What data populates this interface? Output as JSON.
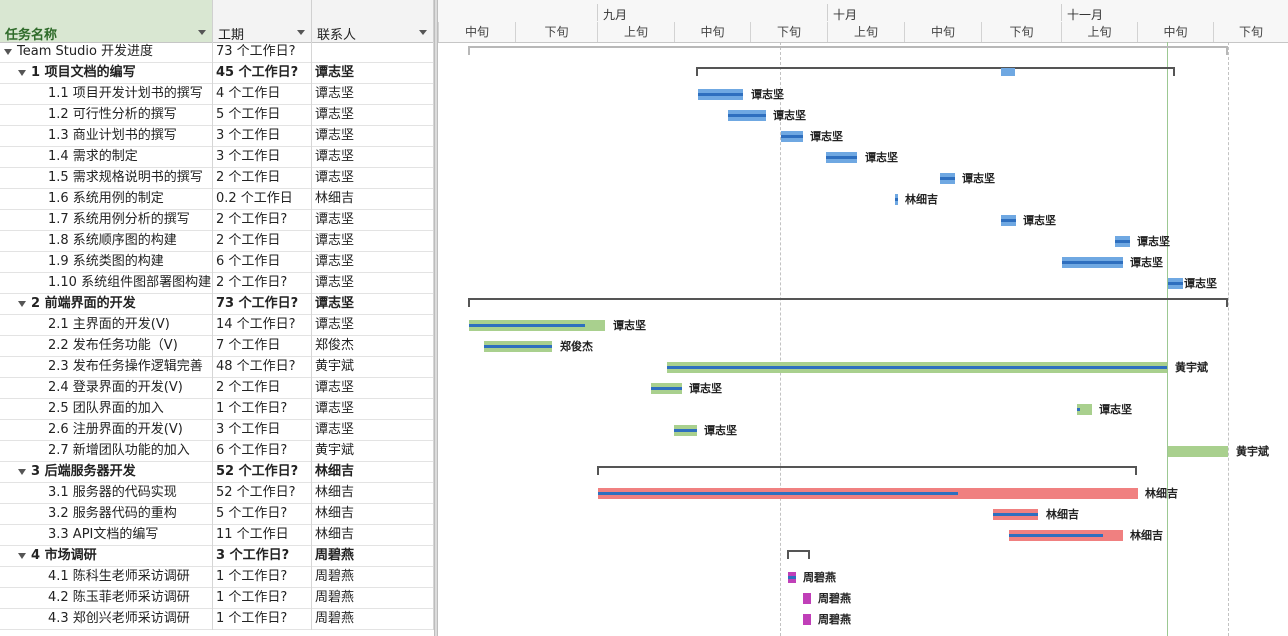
{
  "columns": {
    "name": "任务名称",
    "duration": "工期",
    "contact": "联系人"
  },
  "timescale": {
    "months": [
      "九月",
      "十月",
      "十一月"
    ],
    "periods": [
      "中旬",
      "下旬",
      "上旬",
      "中旬",
      "下旬",
      "上旬",
      "中旬",
      "下旬",
      "上旬",
      "中旬",
      "下旬"
    ]
  },
  "colors": {
    "summary_bar": "#555555",
    "task_blue": "#6fa8e2",
    "task_green": "#a9d08e",
    "task_red": "#f08080",
    "task_magenta": "#c03fb8",
    "progress": "#2e6fbf"
  },
  "tasks": [
    {
      "name": "Team Studio 开发进度",
      "duration": "73 个工作日?",
      "contact": "",
      "level": 0,
      "summary": true
    },
    {
      "name": "1 项目文档的编写",
      "duration": "45 个工作日?",
      "contact": "谭志坚",
      "level": 1,
      "summary": true
    },
    {
      "name": "1.1 项目开发计划书的撰写",
      "duration": "4 个工作日",
      "contact": "谭志坚",
      "level": 2
    },
    {
      "name": "1.2 可行性分析的撰写",
      "duration": "5 个工作日",
      "contact": "谭志坚",
      "level": 2
    },
    {
      "name": "1.3 商业计划书的撰写",
      "duration": "3 个工作日",
      "contact": "谭志坚",
      "level": 2
    },
    {
      "name": "1.4 需求的制定",
      "duration": "3 个工作日",
      "contact": "谭志坚",
      "level": 2
    },
    {
      "name": "1.5 需求规格说明书的撰写",
      "duration": "2 个工作日",
      "contact": "谭志坚",
      "level": 2
    },
    {
      "name": "1.6 系统用例的制定",
      "duration": "0.2 个工作日",
      "contact": "林细吉",
      "level": 2
    },
    {
      "name": "1.7 系统用例分析的撰写",
      "duration": "2 个工作日?",
      "contact": "谭志坚",
      "level": 2
    },
    {
      "name": "1.8 系统顺序图的构建",
      "duration": "2 个工作日",
      "contact": "谭志坚",
      "level": 2
    },
    {
      "name": "1.9 系统类图的构建",
      "duration": "6 个工作日",
      "contact": "谭志坚",
      "level": 2
    },
    {
      "name": "1.10 系统组件图部署图构建",
      "duration": "2 个工作日?",
      "contact": "谭志坚",
      "level": 2
    },
    {
      "name": "2 前端界面的开发",
      "duration": "73 个工作日?",
      "contact": "谭志坚",
      "level": 1,
      "summary": true
    },
    {
      "name": "2.1 主界面的开发(V)",
      "duration": "14 个工作日?",
      "contact": "谭志坚",
      "level": 2
    },
    {
      "name": "2.2 发布任务功能（V)",
      "duration": "7 个工作日",
      "contact": "郑俊杰",
      "level": 2
    },
    {
      "name": "2.3 发布任务操作逻辑完善",
      "duration": "48 个工作日?",
      "contact": "黄宇斌",
      "level": 2
    },
    {
      "name": "2.4 登录界面的开发(V)",
      "duration": "2 个工作日",
      "contact": "谭志坚",
      "level": 2
    },
    {
      "name": "2.5 团队界面的加入",
      "duration": "1 个工作日?",
      "contact": "谭志坚",
      "level": 2
    },
    {
      "name": "2.6 注册界面的开发(V)",
      "duration": "3 个工作日",
      "contact": "谭志坚",
      "level": 2
    },
    {
      "name": "2.7 新增团队功能的加入",
      "duration": "6 个工作日?",
      "contact": "黄宇斌",
      "level": 2
    },
    {
      "name": "3 后端服务器开发",
      "duration": "52 个工作日?",
      "contact": "林细吉",
      "level": 1,
      "summary": true
    },
    {
      "name": "3.1 服务器的代码实现",
      "duration": "52 个工作日?",
      "contact": "林细吉",
      "level": 2
    },
    {
      "name": "3.2 服务器代码的重构",
      "duration": "5 个工作日?",
      "contact": "林细吉",
      "level": 2
    },
    {
      "name": "3.3 API文档的编写",
      "duration": "11 个工作日",
      "contact": "林细吉",
      "level": 2
    },
    {
      "name": "4 市场调研",
      "duration": "3 个工作日?",
      "contact": "周碧燕",
      "level": 1,
      "summary": true
    },
    {
      "name": "4.1 陈科生老师采访调研",
      "duration": "1 个工作日?",
      "contact": "周碧燕",
      "level": 2
    },
    {
      "name": "4.2 陈玉菲老师采访调研",
      "duration": "1 个工作日?",
      "contact": "周碧燕",
      "level": 2
    },
    {
      "name": "4.3 郑创兴老师采访调研",
      "duration": "1 个工作日?",
      "contact": "周碧燕",
      "level": 2
    }
  ]
}
